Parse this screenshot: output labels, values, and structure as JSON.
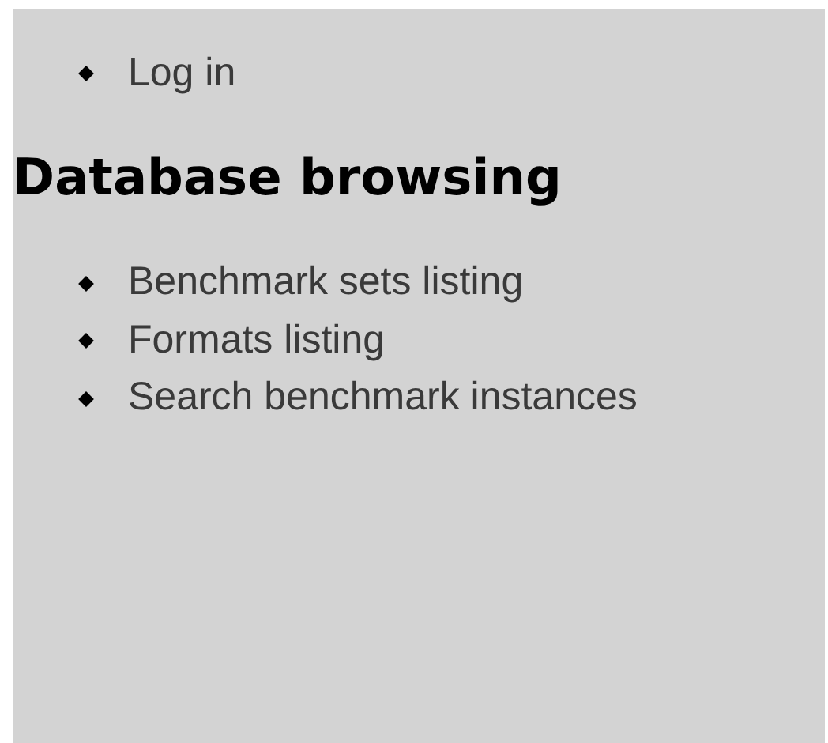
{
  "top_links": [
    {
      "label": "Log in"
    }
  ],
  "section": {
    "heading": "Database browsing",
    "links": [
      {
        "label": "Benchmark sets listing"
      },
      {
        "label": "Formats listing"
      },
      {
        "label": "Search benchmark instances"
      }
    ]
  }
}
